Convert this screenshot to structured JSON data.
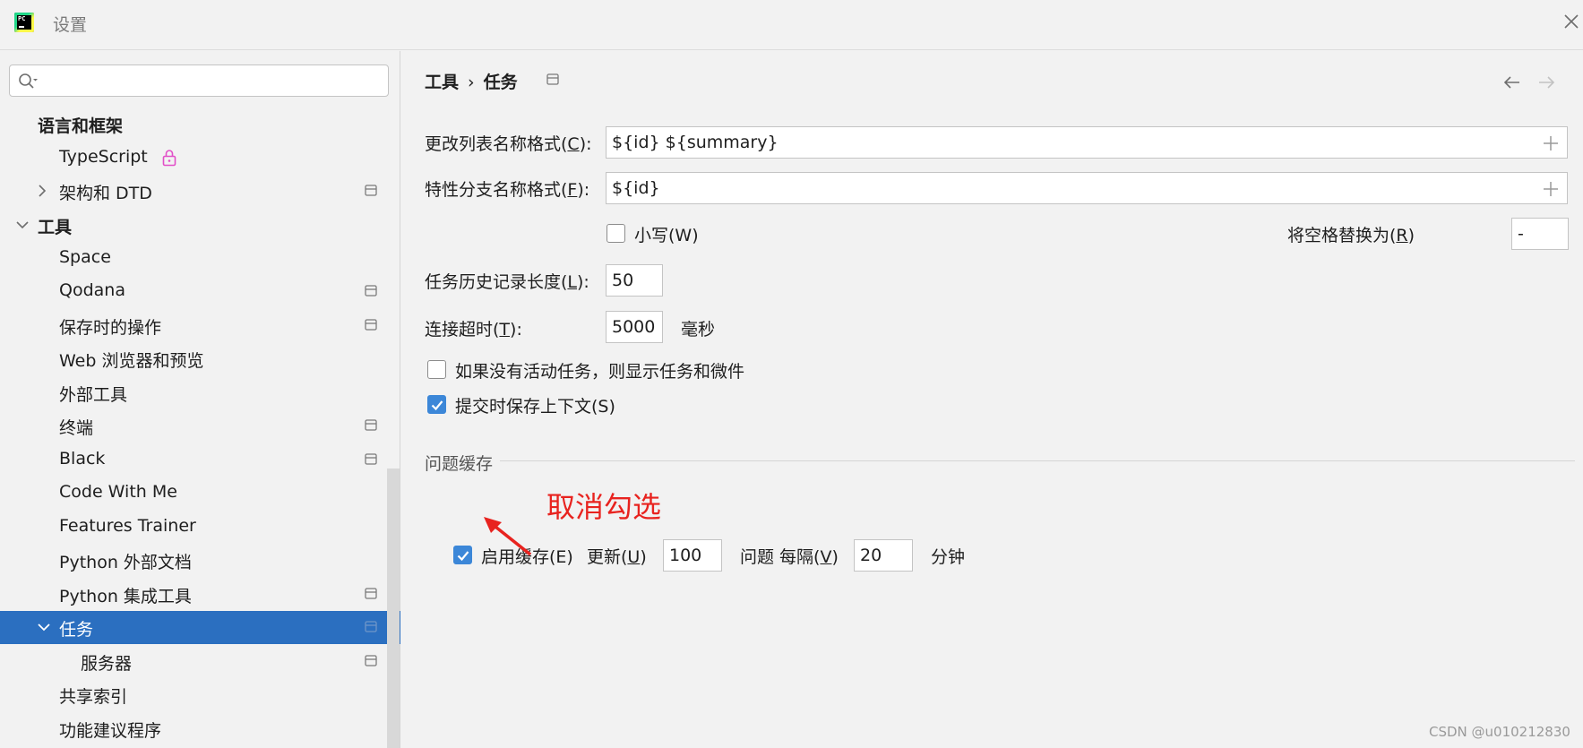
{
  "window": {
    "title": "设置"
  },
  "search": {
    "placeholder": "",
    "value": ""
  },
  "sidebar": {
    "items": [
      {
        "label": "语言和框架"
      },
      {
        "label": "TypeScript"
      },
      {
        "label": "架构和 DTD"
      },
      {
        "label": "工具"
      },
      {
        "label": "Space"
      },
      {
        "label": "Qodana"
      },
      {
        "label": "保存时的操作"
      },
      {
        "label": "Web 浏览器和预览"
      },
      {
        "label": "外部工具"
      },
      {
        "label": "终端"
      },
      {
        "label": "Black"
      },
      {
        "label": "Code With Me"
      },
      {
        "label": "Features Trainer"
      },
      {
        "label": "Python 外部文档"
      },
      {
        "label": "Python 集成工具"
      },
      {
        "label": "任务"
      },
      {
        "label": "服务器"
      },
      {
        "label": "共享索引"
      },
      {
        "label": "功能建议程序"
      }
    ]
  },
  "breadcrumb": {
    "parent": "工具",
    "separator": "›",
    "current": "任务"
  },
  "form": {
    "changelist_label_pre": "更改列表名称格式(",
    "changelist_label_key": "C",
    "changelist_label_post": "):",
    "changelist_value": "${id} ${summary}",
    "branch_label_pre": "特性分支名称格式(",
    "branch_label_key": "F",
    "branch_label_post": "):",
    "branch_value": "${id}",
    "lowercase_label": "小写(W)",
    "replace_spaces_label_pre": "将空格替换为(",
    "replace_spaces_label_key": "R",
    "replace_spaces_label_post": ")",
    "replace_spaces_value": "-",
    "history_label_pre": "任务历史记录长度(",
    "history_label_key": "L",
    "history_label_post": "):",
    "history_value": "50",
    "timeout_label_pre": "连接超时(",
    "timeout_label_key": "T",
    "timeout_label_post": "):",
    "timeout_value": "5000",
    "timeout_unit": "毫秒",
    "show_widget_label": "如果没有活动任务，则显示任务和微件",
    "save_context_label": "提交时保存上下文(S)"
  },
  "cache": {
    "section_title": "问题缓存",
    "enable_label": "启用缓存(E)",
    "update_label_pre": "更新(",
    "update_label_key": "U",
    "update_label_post": ")",
    "update_value": "100",
    "interval_label_pre": "问题 每隔(",
    "interval_label_key": "V",
    "interval_label_post": ")",
    "interval_value": "20",
    "interval_unit": "分钟"
  },
  "annotation": {
    "text": "取消勾选",
    "color": "#e8231f"
  },
  "watermark": "CSDN @u010212830",
  "colors": {
    "selection": "#2b6fc0",
    "checkbox": "#3c87d8",
    "background": "#f2f2f2"
  }
}
